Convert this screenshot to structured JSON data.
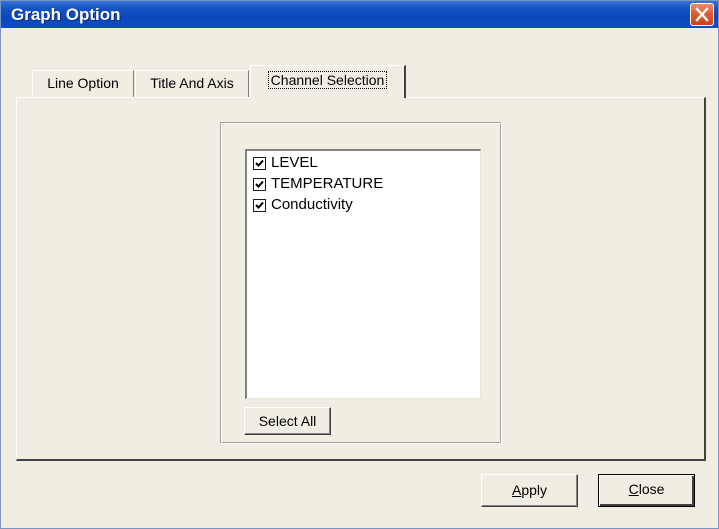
{
  "window": {
    "title": "Graph Option"
  },
  "tabs": [
    {
      "label": "Line Option",
      "active": false
    },
    {
      "label": "Title And Axis",
      "active": false
    },
    {
      "label": "Channel Selection",
      "active": true
    }
  ],
  "channels": {
    "items": [
      {
        "label": "LEVEL",
        "checked": true
      },
      {
        "label": "TEMPERATURE",
        "checked": true
      },
      {
        "label": "Conductivity",
        "checked": true
      }
    ],
    "select_all_label": "Select All"
  },
  "footer": {
    "apply_mnemonic": "A",
    "apply_rest": "pply",
    "close_mnemonic": "C",
    "close_rest": "lose"
  },
  "colors": {
    "title_bar": "#0a48bb",
    "dialog_bg": "#f0ede3",
    "close_button": "#e0582f"
  },
  "icons": {
    "window_close": "close-icon",
    "check": "checkmark-icon"
  }
}
